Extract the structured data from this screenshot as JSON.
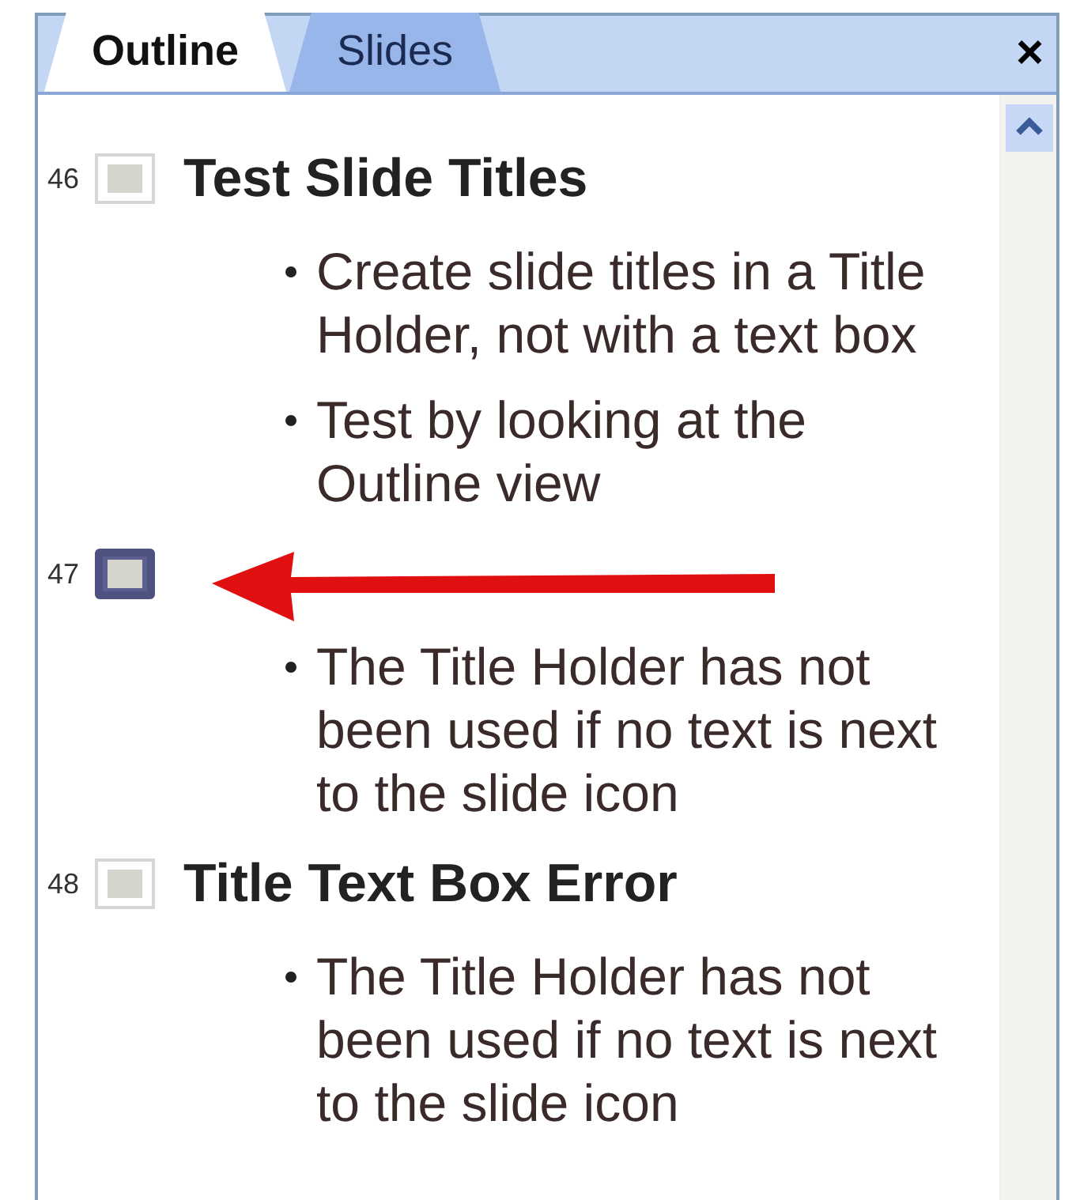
{
  "tabs": [
    {
      "label": "Outline",
      "selected": true
    },
    {
      "label": "Slides",
      "selected": false
    }
  ],
  "close": "×",
  "slides": [
    {
      "number": "46",
      "selected": false,
      "title": "Test Slide Titles",
      "bullets": [
        "Create slide titles in a Title Holder, not with a text box",
        "Test by looking at the Outline view"
      ]
    },
    {
      "number": "47",
      "selected": true,
      "bullets": [
        "The Title Holder has not been used if no text is next to the slide icon"
      ]
    },
    {
      "number": "48",
      "selected": false,
      "title": "Title Text Box Error",
      "bullets": [
        "The Title Holder has not been used if no text is next to the slide icon"
      ]
    }
  ]
}
